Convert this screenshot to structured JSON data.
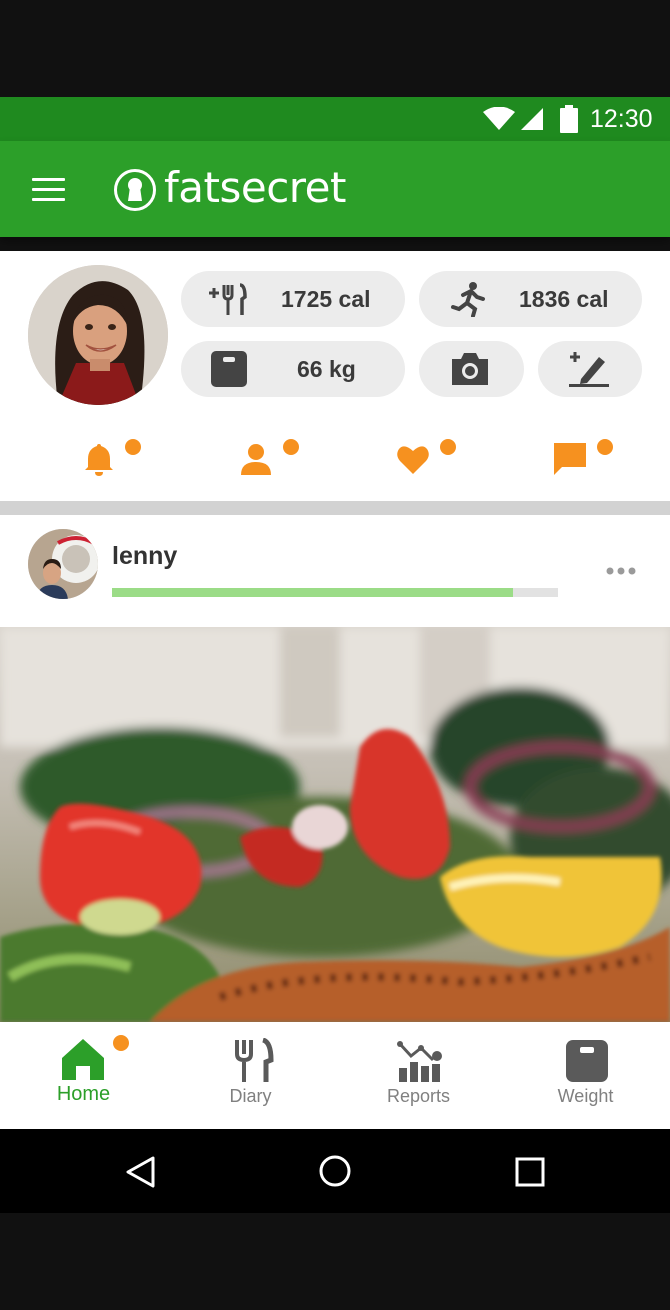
{
  "status_bar": {
    "time": "12:30",
    "icons": [
      "wifi-icon",
      "signal-icon",
      "battery-icon"
    ]
  },
  "app_bar": {
    "menu_icon": "hamburger-menu-icon",
    "logo_icon": "keyhole-logo-icon",
    "logo_text": "fatsecret"
  },
  "profile": {
    "avatar": "user-avatar",
    "food_calories": "1725 cal",
    "exercise_calories": "1836 cal",
    "weight": "66 kg",
    "actions": [
      "camera-icon",
      "add-note-icon"
    ]
  },
  "notifications": [
    {
      "icon": "bell-icon",
      "has_dot": true
    },
    {
      "icon": "person-icon",
      "has_dot": true
    },
    {
      "icon": "heart-icon",
      "has_dot": true
    },
    {
      "icon": "chat-icon",
      "has_dot": true
    }
  ],
  "post": {
    "author": "lenny",
    "progress": 0.9,
    "more_icon": "more-dots-icon",
    "image": "salad-food-photo"
  },
  "bottom_nav": {
    "home": "Home",
    "diary": "Diary",
    "reports": "Reports",
    "weight": "Weight"
  },
  "colors": {
    "status_bar": "#1f8a1f",
    "app_bar": "#2c9f29",
    "accent_orange": "#f6911f",
    "progress_fill": "#9bdc87",
    "nav_inactive": "#808080"
  }
}
